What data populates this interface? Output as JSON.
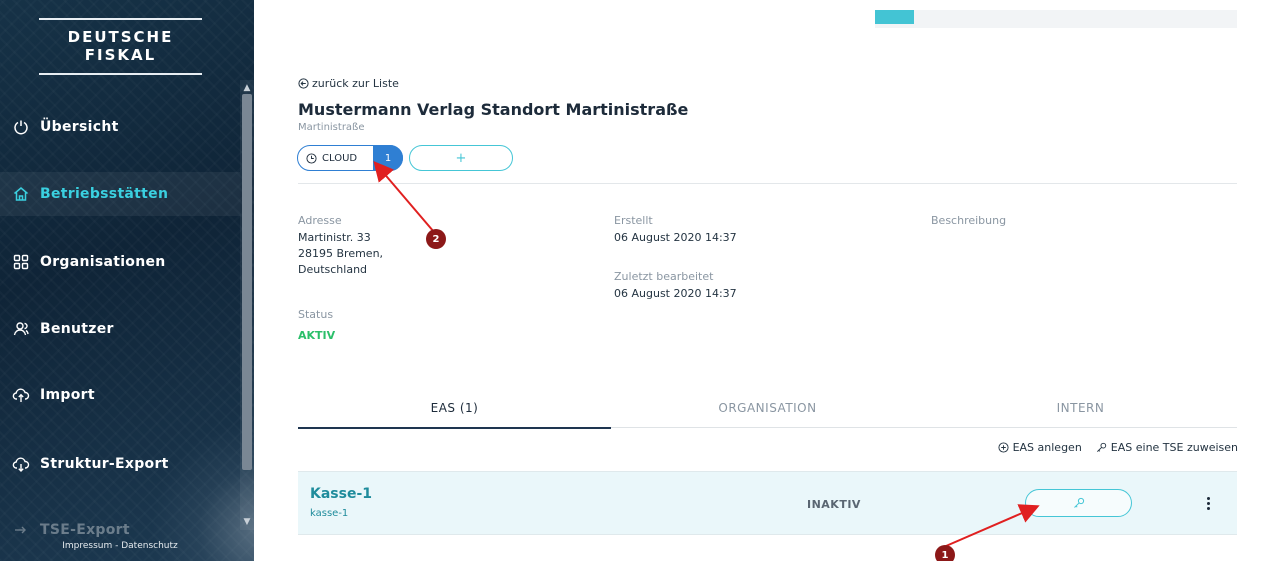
{
  "sidebar": {
    "logo": "DEUTSCHE FISKAL",
    "items": [
      {
        "label": "Übersicht",
        "icon": "power-icon"
      },
      {
        "label": "Betriebsstätten",
        "icon": "home-icon",
        "active": true
      },
      {
        "label": "Organisationen",
        "icon": "grid-icon"
      },
      {
        "label": "Benutzer",
        "icon": "users-icon"
      },
      {
        "label": "Import",
        "icon": "cloud-upload-icon"
      },
      {
        "label": "Struktur-Export",
        "icon": "cloud-download-icon"
      },
      {
        "label": "TSE-Export",
        "icon": "export-icon"
      }
    ],
    "footer": "Impressum - Datenschutz"
  },
  "header": {
    "back_link": "zurück zur Liste",
    "title": "Mustermann Verlag Standort Martinistraße",
    "subtitle": "Martinistraße"
  },
  "tse_pills": {
    "cloud_label": "CLOUD",
    "cloud_count": "1",
    "add_label": "+"
  },
  "details": {
    "address_label": "Adresse",
    "address_line1": "Martinistr. 33",
    "address_line2": "28195 Bremen,",
    "address_line3": "Deutschland",
    "created_label": "Erstellt",
    "created_value": "06 August 2020 14:37",
    "modified_label": "Zuletzt bearbeitet",
    "modified_value": "06 August 2020 14:37",
    "description_label": "Beschreibung",
    "status_label": "Status",
    "status_value": "AKTIV"
  },
  "tabs": [
    {
      "label": "EAS (1)",
      "active": true
    },
    {
      "label": "ORGANISATION"
    },
    {
      "label": "INTERN"
    }
  ],
  "actions": {
    "create_eas": "EAS anlegen",
    "assign_tse": "EAS eine TSE zuweisen"
  },
  "eas_rows": [
    {
      "name": "Kasse-1",
      "id": "kasse-1",
      "state": "INAKTIV"
    }
  ],
  "annotations": [
    {
      "number": "1"
    },
    {
      "number": "2"
    }
  ],
  "colors": {
    "accent": "#43c4d4",
    "primary": "#2f7fd3",
    "status_active": "#2bbf6a",
    "annotation": "#8c1818"
  }
}
